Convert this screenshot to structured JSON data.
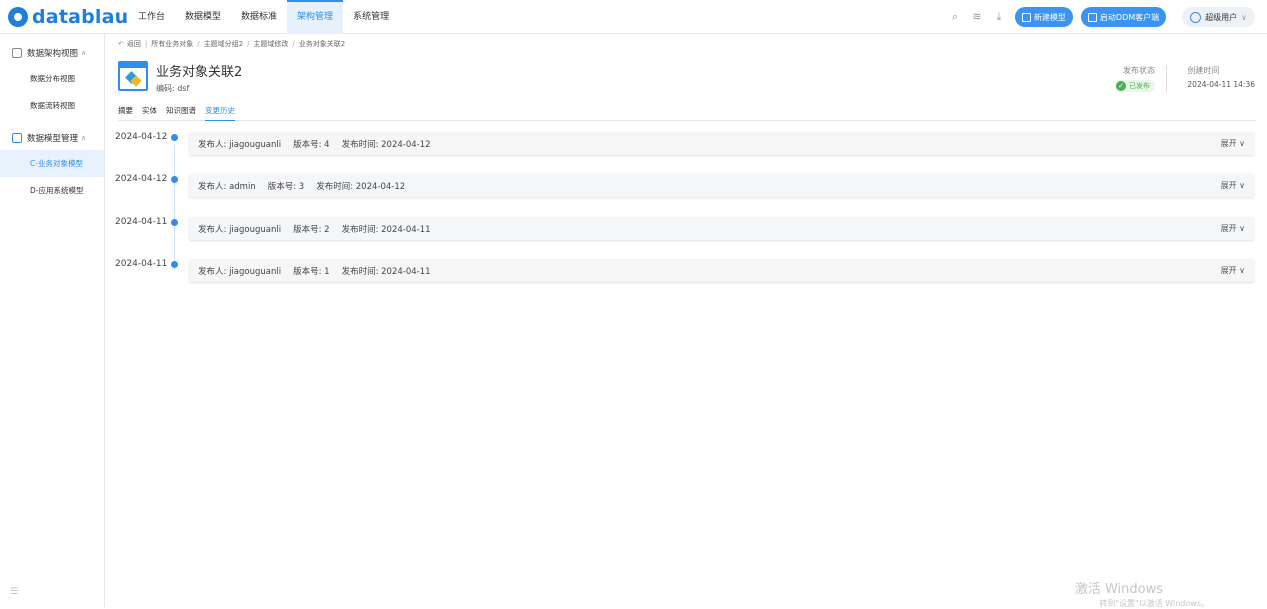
{
  "brand": {
    "logo_text": "datablau"
  },
  "nav": [
    "工作台",
    "数据模型",
    "数据标准",
    "架构管理",
    "系统管理"
  ],
  "toolbar": {
    "new_model": "新建模型",
    "launch_ddm": "启动DDM客户端",
    "user": "超级用户"
  },
  "sidebar": {
    "group1": "数据架构视图",
    "group1_items": [
      "数据分布视图",
      "数据流转视图"
    ],
    "group2": "数据模型管理",
    "group2_items": [
      "C-业务对象模型",
      "D-应用系统模型"
    ]
  },
  "breadcrumb": {
    "back": "返回",
    "path": [
      "所有业务对象",
      "主题域分组2",
      "主题域修改",
      "业务对象关联2"
    ]
  },
  "object": {
    "title": "业务对象关联2",
    "code": "编码: dsf"
  },
  "status": {
    "label": "发布状态",
    "value": "已发布",
    "color": "#4cb050"
  },
  "created": {
    "label": "创建时间",
    "value": "2024-04-11 14:36"
  },
  "tabs": [
    "摘要",
    "实体",
    "知识图谱",
    "变更历史"
  ],
  "history": [
    {
      "date": "2024-04-12",
      "publisher": "发布人: jiagouguanli",
      "version": "版本号: 4",
      "time": "发布时间: 2024-04-12",
      "expand": "展开 ∨"
    },
    {
      "date": "2024-04-12",
      "publisher": "发布人: admin",
      "version": "版本号: 3",
      "time": "发布时间: 2024-04-12",
      "expand": "展开 ∨"
    },
    {
      "date": "2024-04-11",
      "publisher": "发布人: jiagouguanli",
      "version": "版本号: 2",
      "time": "发布时间: 2024-04-11",
      "expand": "展开 ∨"
    },
    {
      "date": "2024-04-11",
      "publisher": "发布人: jiagouguanli",
      "version": "版本号: 1",
      "time": "发布时间: 2024-04-11",
      "expand": "展开 ∨"
    }
  ],
  "watermark": {
    "line1": "激活 Windows",
    "line2": "转到\"设置\"以激活 Windows。"
  },
  "colors": {
    "accent": "#2f8ef0",
    "brand": "#1e7fe0"
  }
}
